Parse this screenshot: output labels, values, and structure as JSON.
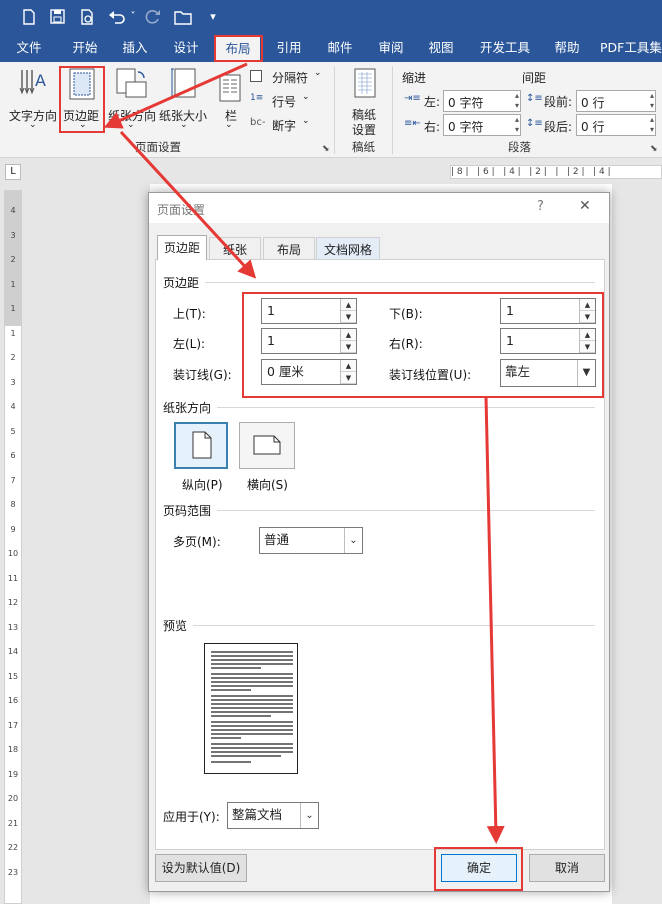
{
  "quick_access": {
    "undo_dropdown": "˅",
    "customize": "▾"
  },
  "tabs": [
    "文件",
    "开始",
    "插入",
    "设计",
    "布局",
    "引用",
    "邮件",
    "审阅",
    "视图",
    "开发工具",
    "帮助",
    "PDF工具集"
  ],
  "ribbon": {
    "text_direction": "文字方向",
    "margins": "页边距",
    "orientation": "纸张方向",
    "size": "纸张大小",
    "columns": "栏",
    "breaks": "分隔符",
    "line_numbers": "行号",
    "hyphenation": "断字",
    "manuscript": [
      "稿纸",
      "设置"
    ],
    "manuscript_group": "稿纸",
    "page_setup_group": "页面设置",
    "indent_title": "缩进",
    "spacing_title": "间距",
    "indent_left_label": "左:",
    "indent_left_value": "0 字符",
    "indent_right_label": "右:",
    "indent_right_value": "0 字符",
    "spacing_before_label": "段前:",
    "spacing_before_value": "0 行",
    "spacing_after_label": "段后:",
    "spacing_after_value": "0 行",
    "paragraph_group": "段落"
  },
  "ruler": {
    "h_ticks": "| 8 |   | 6 |   | 4 |   | 2 |   |   | 2 |   | 4 |",
    "v_ticks": "4 3 2 1 1 1 2 3 4 5 6 7 8 9 10 11 12 13 14 15 16 17 18 19 20 21 22 23"
  },
  "dialog": {
    "title": "页面设置",
    "help": "?",
    "close": "✕",
    "tabs": [
      "页边距",
      "纸张",
      "布局",
      "文档网格"
    ],
    "margins_section": "页边距",
    "top_label": "上(T):",
    "top_value": "1",
    "bottom_label": "下(B):",
    "bottom_value": "1",
    "left_label": "左(L):",
    "left_value": "1",
    "right_label": "右(R):",
    "right_value": "1",
    "gutter_label": "装订线(G):",
    "gutter_value": "0 厘米",
    "gutter_pos_label": "装订线位置(U):",
    "gutter_pos_value": "靠左",
    "orientation_section": "纸张方向",
    "portrait": "纵向(P)",
    "landscape": "横向(S)",
    "pages_section": "页码范围",
    "multiple_pages_label": "多页(M):",
    "multiple_pages_value": "普通",
    "preview_section": "预览",
    "apply_to_label": "应用于(Y):",
    "apply_to_value": "整篇文档",
    "set_default": "设为默认值(D)",
    "ok": "确定",
    "cancel": "取消"
  },
  "colors": {
    "brand": "#2b579a",
    "highlight": "#e53935"
  }
}
